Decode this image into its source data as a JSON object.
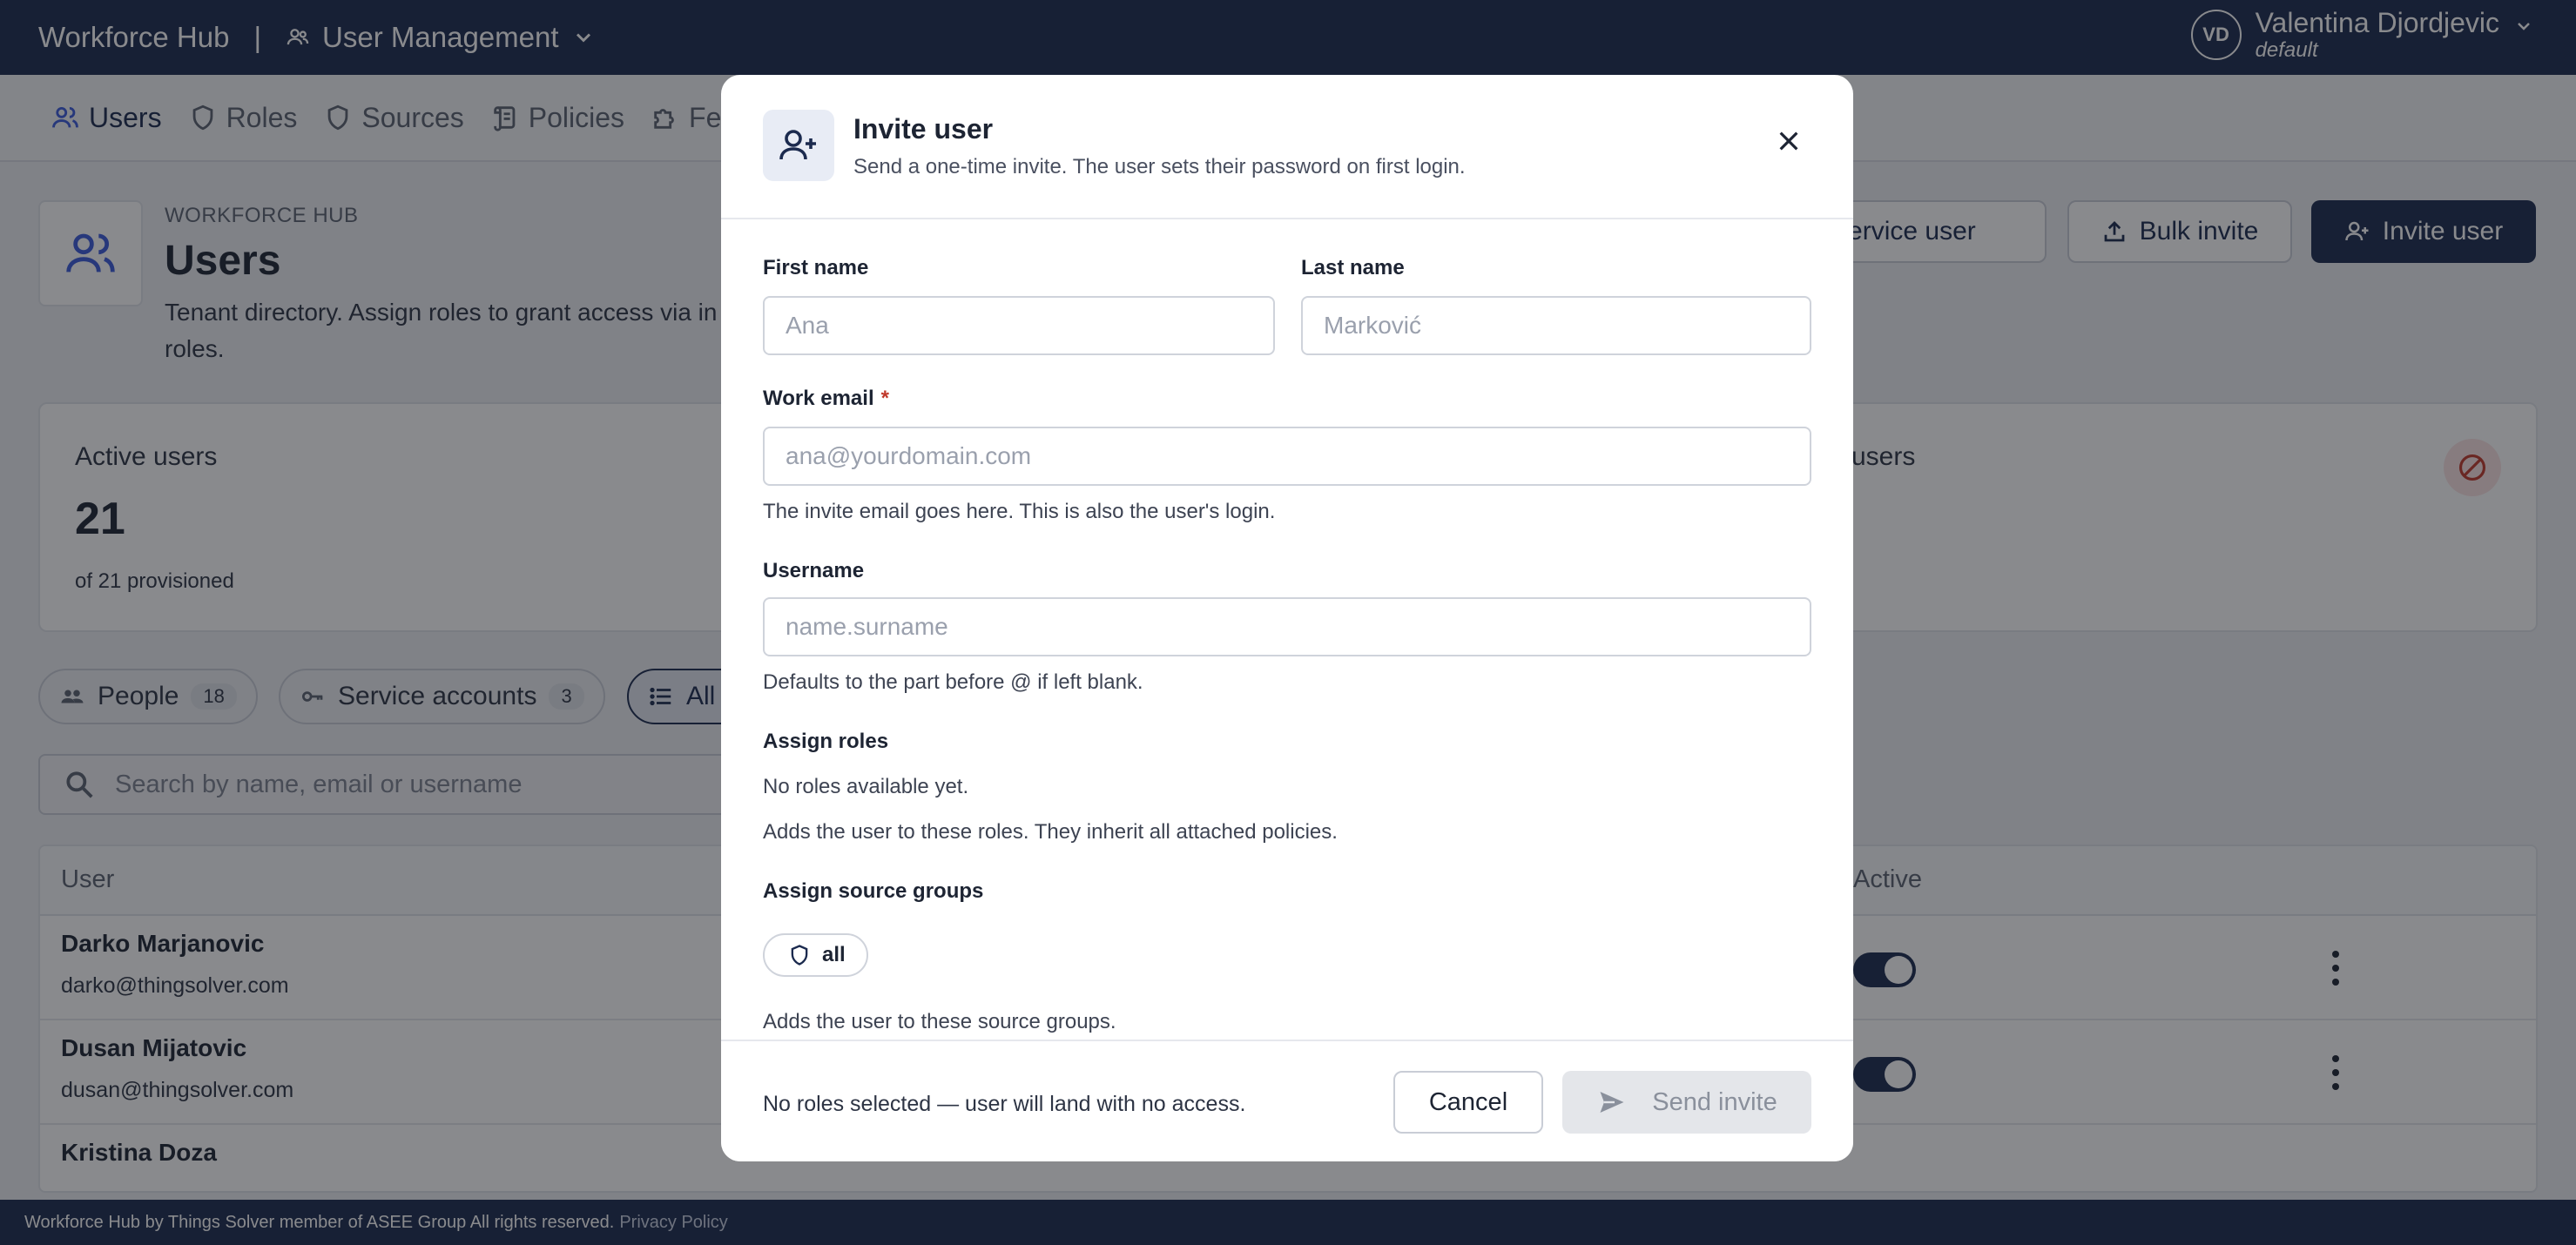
{
  "topbar": {
    "brand": "Workforce Hub",
    "separator": "|",
    "module": "User Management",
    "user": {
      "initials": "VD",
      "name": "Valentina Djordjevic",
      "tenant": "default"
    }
  },
  "nav": {
    "items": [
      {
        "label": "Users",
        "active": true
      },
      {
        "label": "Roles"
      },
      {
        "label": "Sources"
      },
      {
        "label": "Policies"
      },
      {
        "label": "Fe"
      }
    ]
  },
  "page": {
    "eyebrow": "WORKFORCE HUB",
    "title": "Users",
    "description": "Tenant directory. Assign roles to grant access via in\nroles.",
    "actions": {
      "service_user": "e service user",
      "bulk_invite": "Bulk invite",
      "invite_user": "Invite user"
    }
  },
  "stats": {
    "active_label": "Active users",
    "active_value": "21",
    "active_sub": "of 21 provisioned",
    "inactive_label": "users"
  },
  "filters": {
    "people": {
      "label": "People",
      "count": "18"
    },
    "service_accounts": {
      "label": "Service accounts",
      "count": "3"
    },
    "all": {
      "label": "All"
    }
  },
  "search": {
    "placeholder": "Search by name, email or username"
  },
  "table": {
    "headers": {
      "user": "User",
      "active": "Active"
    },
    "rows": [
      {
        "name": "Darko Marjanovic",
        "email": "darko@thingsolver.com",
        "active": true
      },
      {
        "name": "Dusan Mijatovic",
        "email": "dusan@thingsolver.com",
        "active": true
      },
      {
        "name": "Kristina Doza",
        "email": "",
        "active": true
      }
    ]
  },
  "footer": {
    "text": "Workforce Hub by Things Solver member of ASEE Group All rights reserved.",
    "privacy": "Privacy Policy"
  },
  "modal": {
    "title": "Invite user",
    "subtitle": "Send a one-time invite. The user sets their password on first login.",
    "first_name": {
      "label": "First name",
      "placeholder": "Ana",
      "value": ""
    },
    "last_name": {
      "label": "Last name",
      "placeholder": "Marković",
      "value": ""
    },
    "email": {
      "label": "Work email",
      "required_mark": "*",
      "placeholder": "ana@yourdomain.com",
      "value": "",
      "help": "The invite email goes here. This is also the user's login."
    },
    "username": {
      "label": "Username",
      "placeholder": "name.surname",
      "value": "",
      "help": "Defaults to the part before @ if left blank."
    },
    "roles": {
      "label": "Assign roles",
      "empty": "No roles available yet.",
      "help": "Adds the user to these roles. They inherit all attached policies."
    },
    "source_groups": {
      "label": "Assign source groups",
      "options": [
        "all"
      ],
      "help": "Adds the user to these source groups."
    },
    "footer_note": "No roles selected — user will land with no access.",
    "cancel": "Cancel",
    "send": "Send invite"
  },
  "colors": {
    "navy": "#1b2a4e",
    "required": "#c0392b",
    "danger_badge": "#fbe3e3"
  }
}
